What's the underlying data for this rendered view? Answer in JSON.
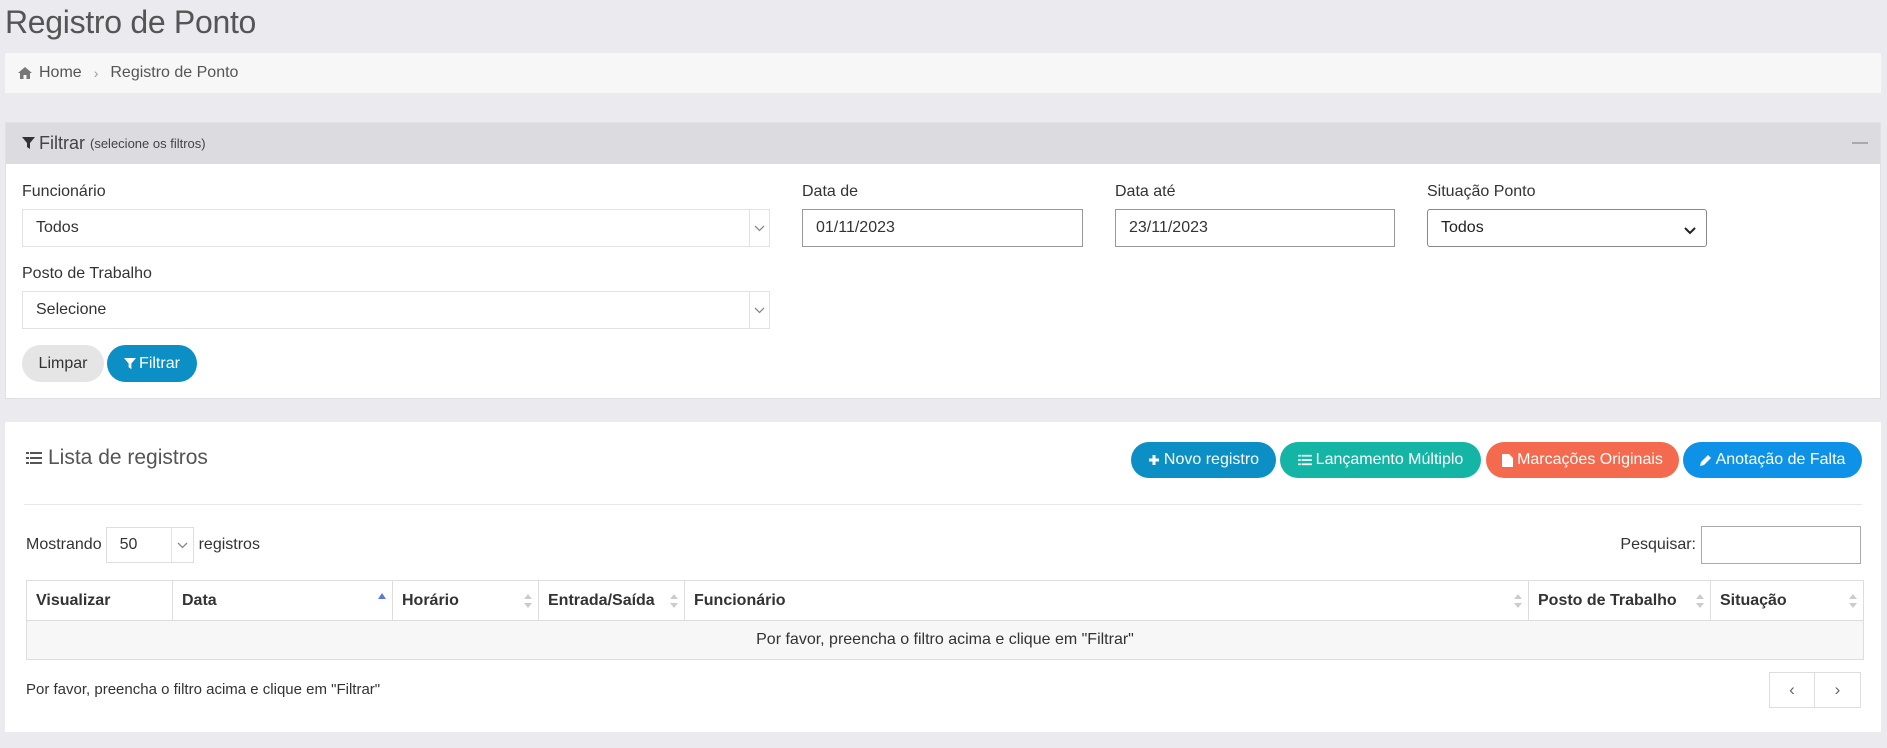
{
  "page": {
    "title": "Registro de Ponto"
  },
  "breadcrumb": {
    "home": "Home",
    "current": "Registro de Ponto"
  },
  "filter": {
    "heading": "Filtrar",
    "subheading": "(selecione os filtros)",
    "employee_label": "Funcionário",
    "employee_value": "Todos",
    "date_from_label": "Data de",
    "date_from_value": "01/11/2023",
    "date_to_label": "Data até",
    "date_to_value": "23/11/2023",
    "status_label": "Situação Ponto",
    "status_value": "Todos",
    "workpost_label": "Posto de Trabalho",
    "workpost_value": "Selecione",
    "clear_label": "Limpar",
    "filter_label": "Filtrar"
  },
  "list": {
    "title": "Lista de registros",
    "actions": [
      {
        "label": "Novo registro",
        "color": "#0b8fc4",
        "icon": "plus-icon"
      },
      {
        "label": "Lançamento Múltiplo",
        "color": "#14b5a5",
        "icon": "list-icon"
      },
      {
        "label": "Marcações Originais",
        "color": "#f46a4e",
        "icon": "file-icon"
      },
      {
        "label": "Anotação de Falta",
        "color": "#0d92e8",
        "icon": "pencil-icon"
      }
    ],
    "length_prefix": "Mostrando",
    "length_value": "50",
    "length_suffix": "registros",
    "search_label": "Pesquisar:",
    "search_value": "",
    "columns": [
      "Visualizar",
      "Data",
      "Horário",
      "Entrada/Saída",
      "Funcionário",
      "Posto de Trabalho",
      "Situação"
    ],
    "empty_message": "Por favor, preencha o filtro acima e clique em \"Filtrar\"",
    "info": "Por favor, preencha o filtro acima e clique em \"Filtrar\"",
    "pager_prev": "‹",
    "pager_next": "›"
  }
}
